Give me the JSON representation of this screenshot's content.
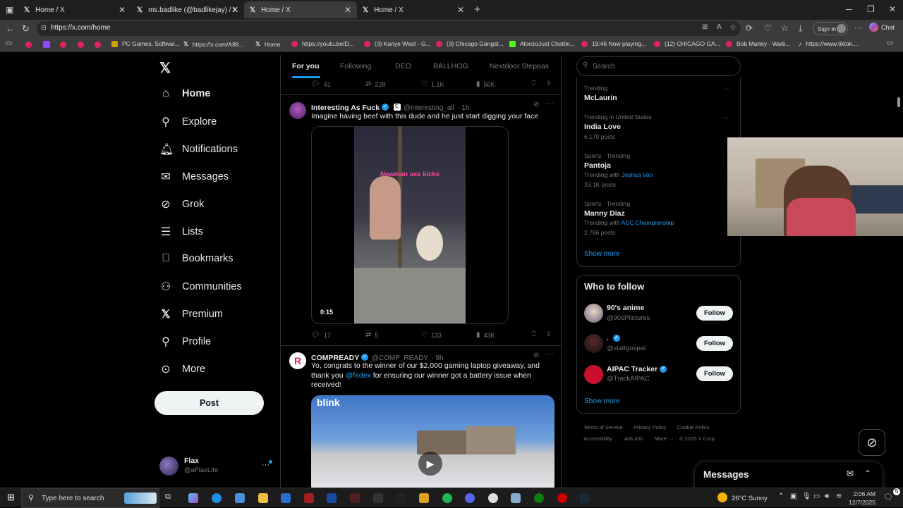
{
  "browser": {
    "tabs": [
      {
        "title": "Home / X"
      },
      {
        "title": "ms.badlike (@badlikejay) / X"
      },
      {
        "title": "Home / X"
      },
      {
        "title": "Home / X"
      }
    ],
    "url": "https://x.com/home",
    "sign_in": "Sign in",
    "chat": "Chat",
    "bookmarks": [
      "PC Games, Softwar...",
      "https://x.com/A88...",
      "Home",
      "https://youtu.be/D...",
      "(3) Kanye West - G...",
      "(3) Chicago Gangst...",
      "AlonzoJust Chattin...",
      "19:46 Now playing...",
      "(12) CHICAGO GA...",
      "Bob Marley - Waiti...",
      "https://www.tiktok...."
    ]
  },
  "nav": {
    "items": [
      "Home",
      "Explore",
      "Notifications",
      "Messages",
      "Grok",
      "Lists",
      "Bookmarks",
      "Communities",
      "Premium",
      "Profile",
      "More"
    ],
    "post_label": "Post",
    "profile": {
      "name": "Flax",
      "handle": "@aFlaxLife"
    }
  },
  "feed": {
    "tabs": [
      "For you",
      "Following",
      "DEO",
      "BALLHOG",
      "Nextdoor Steppas"
    ],
    "prev_stats": {
      "replies": "41",
      "reposts": "228",
      "likes": "1.1K",
      "views": "56K"
    },
    "tweets": [
      {
        "name": "Interesting As Fuck",
        "badge": "C",
        "handle": "@interesting_all",
        "time": "· 1h",
        "text": "Imagine having beef with this dude and he just start digging your face",
        "video_caption": "Newman axe kicks",
        "duration": "0:15",
        "stats": {
          "replies": "17",
          "reposts": "5",
          "likes": "133",
          "views": "43K"
        }
      },
      {
        "name": "COMPREADY",
        "handle": "@COMP_READY",
        "time": "· 9h",
        "text_1": "Yo, congrats to the winner of our $2,000 gaming laptop giveaway, and",
        "text_2a": "thank you ",
        "mention": "@fedex",
        "text_2b": " for ensuring our winner got a battery issue when",
        "text_3": "received!",
        "media_label": "blink"
      }
    ]
  },
  "right": {
    "search_placeholder": "Search",
    "trends": [
      {
        "context": "Trending",
        "name": "McLaurin"
      },
      {
        "context": "Trending in United States",
        "name": "India Love",
        "posts": "6,179 posts"
      },
      {
        "context": "Sports · Trending",
        "name": "Pantoja",
        "with_label": "Trending with ",
        "with": "Joshua Van",
        "posts": "33.1K posts"
      },
      {
        "context": "Sports · Trending",
        "name": "Manny Diaz",
        "with_label": "Trending with ",
        "with": "ACC Championship",
        "posts": "2,766 posts"
      }
    ],
    "show_more": "Show more",
    "who_to_follow": {
      "title": "Who to follow",
      "accounts": [
        {
          "name": "90's anime",
          "handle": "@90sPlictures"
        },
        {
          "name": ".",
          "handle": "@slattgospal"
        },
        {
          "name": "AIPAC Tracker",
          "handle": "@TrackAIPAC"
        }
      ],
      "follow_label": "Follow",
      "show_more": "Show more"
    },
    "footer": [
      "Terms of Service",
      "Privacy Policy",
      "Cookie Policy",
      "Accessibility",
      "Ads info",
      "More ···",
      "© 2025 X Corp."
    ],
    "messages": "Messages"
  },
  "taskbar": {
    "search_placeholder": "Type here to search",
    "weather": "26°C  Sunny",
    "time": "2:06 AM",
    "date": "12/7/2025"
  }
}
